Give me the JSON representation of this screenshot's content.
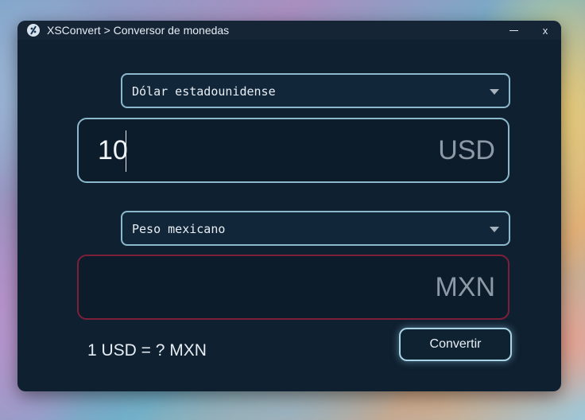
{
  "window": {
    "title": "XSConvert > Conversor de monedas",
    "minimize_label": "",
    "close_label": "x"
  },
  "from": {
    "currency_name": "Dólar estadounidense",
    "amount": "10",
    "code": "USD"
  },
  "to": {
    "currency_name": "Peso mexicano",
    "amount": "",
    "code": "MXN"
  },
  "rate_text": "1 USD = ? MXN",
  "convert_button_label": "Convertir",
  "colors": {
    "window_bg": "#0f2030",
    "input_border": "#8cb8cc",
    "output_border": "#7e1f3a",
    "button_glow": "#a8d4e6"
  }
}
